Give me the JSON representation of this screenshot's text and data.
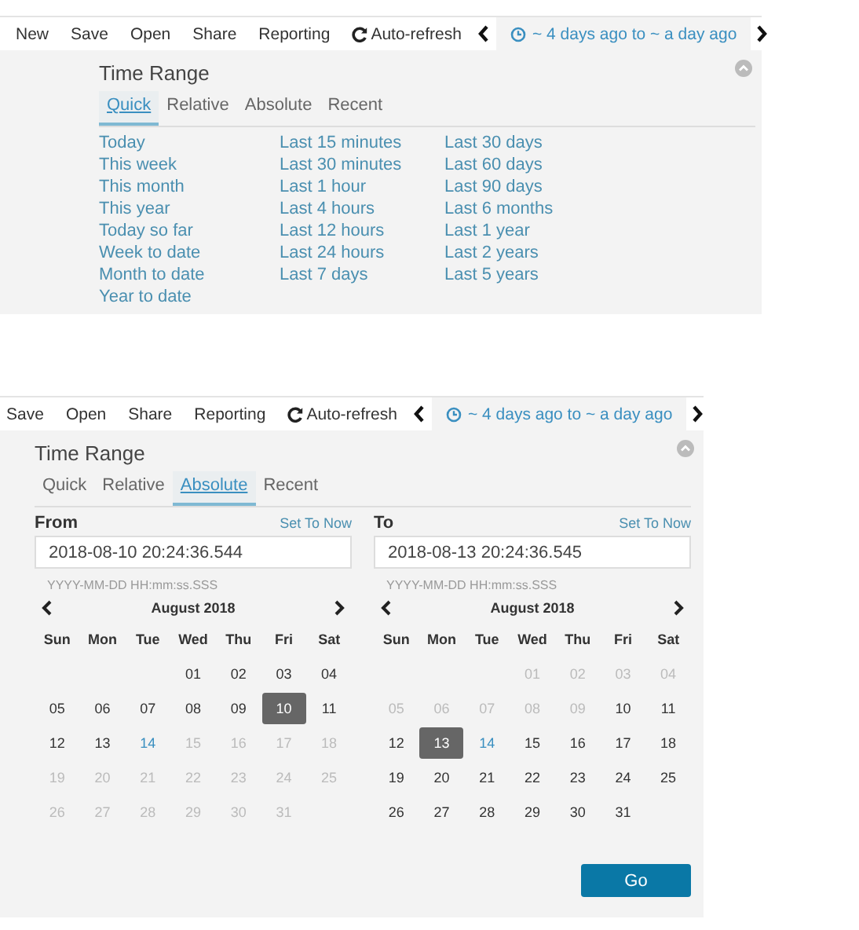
{
  "panels": [
    {
      "kind": "quick",
      "toolbar": {
        "items": [
          {
            "label": "New",
            "kind": "text"
          },
          {
            "label": "Save",
            "kind": "text"
          },
          {
            "label": "Open",
            "kind": "text"
          },
          {
            "label": "Share",
            "kind": "text"
          },
          {
            "label": "Reporting",
            "kind": "text"
          },
          {
            "label": "Auto-refresh",
            "kind": "refresh"
          }
        ],
        "range": "~ 4 days ago to ~ a day ago"
      },
      "title": "Time Range",
      "tabs": [
        {
          "label": "Quick",
          "selected": true
        },
        {
          "label": "Relative",
          "selected": false
        },
        {
          "label": "Absolute",
          "selected": false
        },
        {
          "label": "Recent",
          "selected": false
        }
      ],
      "quick_columns": [
        [
          "Today",
          "This week",
          "This month",
          "This year",
          "Today so far",
          "Week to date",
          "Month to date",
          "Year to date"
        ],
        [
          "Last 15 minutes",
          "Last 30 minutes",
          "Last 1 hour",
          "Last 4 hours",
          "Last 12 hours",
          "Last 24 hours",
          "Last 7 days"
        ],
        [
          "Last 30 days",
          "Last 60 days",
          "Last 90 days",
          "Last 6 months",
          "Last 1 year",
          "Last 2 years",
          "Last 5 years"
        ]
      ]
    },
    {
      "kind": "absolute",
      "toolbar": {
        "items": [
          {
            "label": "Save",
            "kind": "text"
          },
          {
            "label": "Open",
            "kind": "text"
          },
          {
            "label": "Share",
            "kind": "text"
          },
          {
            "label": "Reporting",
            "kind": "text"
          },
          {
            "label": "Auto-refresh",
            "kind": "refresh"
          }
        ],
        "range": "~ 4 days ago to ~ a day ago"
      },
      "title": "Time Range",
      "tabs": [
        {
          "label": "Quick",
          "selected": false
        },
        {
          "label": "Relative",
          "selected": false
        },
        {
          "label": "Absolute",
          "selected": true
        },
        {
          "label": "Recent",
          "selected": false
        }
      ],
      "dates": [
        {
          "label": "From",
          "set_now": "Set To Now",
          "value": "2018-08-10 20:24:36.544",
          "format_hint": "YYYY-MM-DD HH:mm:ss.SSS",
          "calendar": {
            "month": "August 2018",
            "weekdays": [
              "Sun",
              "Mon",
              "Tue",
              "Wed",
              "Thu",
              "Fri",
              "Sat"
            ],
            "weeks": [
              [
                {
                  "kind": "blank"
                },
                {
                  "kind": "blank"
                },
                {
                  "kind": "blank"
                },
                {
                  "d": "01",
                  "kind": "normal"
                },
                {
                  "d": "02",
                  "kind": "normal"
                },
                {
                  "d": "03",
                  "kind": "normal"
                },
                {
                  "d": "04",
                  "kind": "normal"
                }
              ],
              [
                {
                  "d": "05",
                  "kind": "normal"
                },
                {
                  "d": "06",
                  "kind": "normal"
                },
                {
                  "d": "07",
                  "kind": "normal"
                },
                {
                  "d": "08",
                  "kind": "normal"
                },
                {
                  "d": "09",
                  "kind": "normal"
                },
                {
                  "d": "10",
                  "kind": "selected"
                },
                {
                  "d": "11",
                  "kind": "normal"
                }
              ],
              [
                {
                  "d": "12",
                  "kind": "normal"
                },
                {
                  "d": "13",
                  "kind": "normal"
                },
                {
                  "d": "14",
                  "kind": "today"
                },
                {
                  "d": "15",
                  "kind": "muted"
                },
                {
                  "d": "16",
                  "kind": "muted"
                },
                {
                  "d": "17",
                  "kind": "muted"
                },
                {
                  "d": "18",
                  "kind": "muted"
                }
              ],
              [
                {
                  "d": "19",
                  "kind": "muted"
                },
                {
                  "d": "20",
                  "kind": "muted"
                },
                {
                  "d": "21",
                  "kind": "muted"
                },
                {
                  "d": "22",
                  "kind": "muted"
                },
                {
                  "d": "23",
                  "kind": "muted"
                },
                {
                  "d": "24",
                  "kind": "muted"
                },
                {
                  "d": "25",
                  "kind": "muted"
                }
              ],
              [
                {
                  "d": "26",
                  "kind": "muted"
                },
                {
                  "d": "27",
                  "kind": "muted"
                },
                {
                  "d": "28",
                  "kind": "muted"
                },
                {
                  "d": "29",
                  "kind": "muted"
                },
                {
                  "d": "30",
                  "kind": "muted"
                },
                {
                  "d": "31",
                  "kind": "muted"
                },
                {
                  "kind": "blank"
                }
              ]
            ]
          }
        },
        {
          "label": "To",
          "set_now": "Set To Now",
          "value": "2018-08-13 20:24:36.545",
          "format_hint": "YYYY-MM-DD HH:mm:ss.SSS",
          "calendar": {
            "month": "August 2018",
            "weekdays": [
              "Sun",
              "Mon",
              "Tue",
              "Wed",
              "Thu",
              "Fri",
              "Sat"
            ],
            "weeks": [
              [
                {
                  "kind": "blank"
                },
                {
                  "kind": "blank"
                },
                {
                  "kind": "blank"
                },
                {
                  "d": "01",
                  "kind": "muted"
                },
                {
                  "d": "02",
                  "kind": "muted"
                },
                {
                  "d": "03",
                  "kind": "muted"
                },
                {
                  "d": "04",
                  "kind": "muted"
                }
              ],
              [
                {
                  "d": "05",
                  "kind": "muted"
                },
                {
                  "d": "06",
                  "kind": "muted"
                },
                {
                  "d": "07",
                  "kind": "muted"
                },
                {
                  "d": "08",
                  "kind": "muted"
                },
                {
                  "d": "09",
                  "kind": "muted"
                },
                {
                  "d": "10",
                  "kind": "normal"
                },
                {
                  "d": "11",
                  "kind": "normal"
                }
              ],
              [
                {
                  "d": "12",
                  "kind": "normal"
                },
                {
                  "d": "13",
                  "kind": "selected"
                },
                {
                  "d": "14",
                  "kind": "today"
                },
                {
                  "d": "15",
                  "kind": "normal"
                },
                {
                  "d": "16",
                  "kind": "normal"
                },
                {
                  "d": "17",
                  "kind": "normal"
                },
                {
                  "d": "18",
                  "kind": "normal"
                }
              ],
              [
                {
                  "d": "19",
                  "kind": "normal"
                },
                {
                  "d": "20",
                  "kind": "normal"
                },
                {
                  "d": "21",
                  "kind": "normal"
                },
                {
                  "d": "22",
                  "kind": "normal"
                },
                {
                  "d": "23",
                  "kind": "normal"
                },
                {
                  "d": "24",
                  "kind": "normal"
                },
                {
                  "d": "25",
                  "kind": "normal"
                }
              ],
              [
                {
                  "d": "26",
                  "kind": "normal"
                },
                {
                  "d": "27",
                  "kind": "normal"
                },
                {
                  "d": "28",
                  "kind": "normal"
                },
                {
                  "d": "29",
                  "kind": "normal"
                },
                {
                  "d": "30",
                  "kind": "normal"
                },
                {
                  "d": "31",
                  "kind": "normal"
                },
                {
                  "kind": "blank"
                }
              ]
            ]
          }
        }
      ],
      "go": "Go"
    }
  ]
}
